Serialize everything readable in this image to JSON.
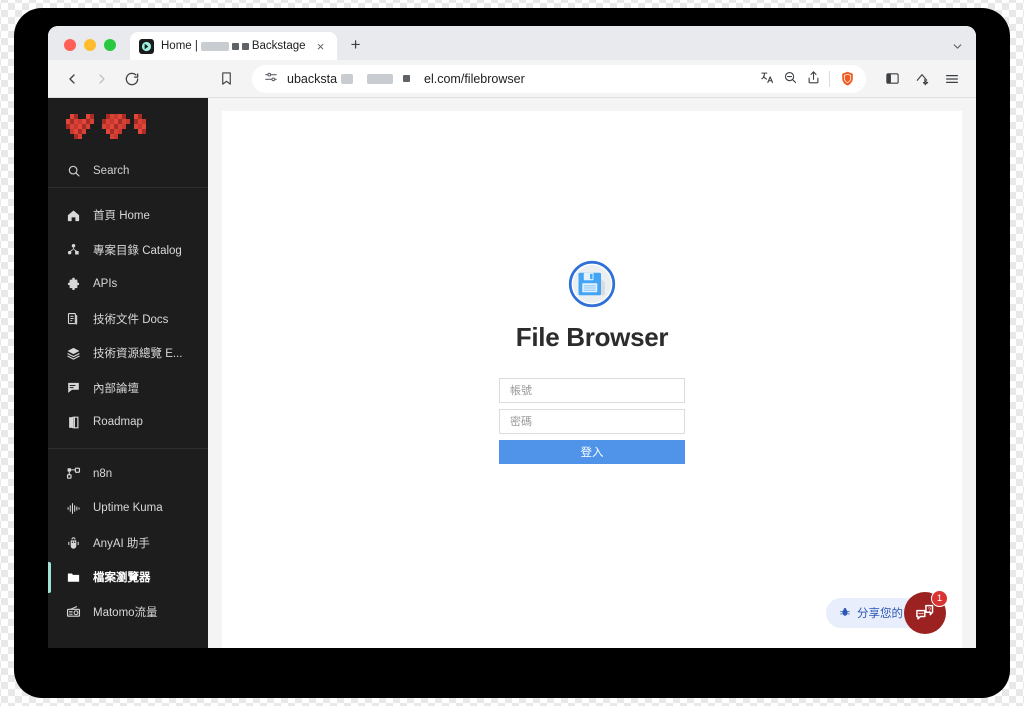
{
  "window": {
    "traffic_lights": [
      "close",
      "minimize",
      "maximize"
    ],
    "tab": {
      "title_prefix": "Home |",
      "title_suffix": "Backstage",
      "favicon": "backstage-favicon",
      "close_label": "×"
    },
    "new_tab_label": "+",
    "tabstrip_chevron": "chevron-down-icon"
  },
  "toolbar": {
    "back": "back-arrow-icon",
    "forward": "forward-arrow-icon",
    "reload": "reload-icon",
    "bookmark": "bookmark-icon",
    "omnibox": {
      "permissions_icon": "site-settings-icon",
      "url_prefix": "ubacksta",
      "url_suffix": "el.com/filebrowser"
    },
    "translate": "translate-icon",
    "zoom_out": "zoom-out-icon",
    "share": "share-icon",
    "shields": "brave-shields-icon",
    "side_panel": "side-panel-icon",
    "leo_ai": "leo-sparkle-icon",
    "menu": "hamburger-menu-icon"
  },
  "sidebar": {
    "logo": "redacted-logo",
    "search": {
      "label": "Search",
      "icon": "search-icon"
    },
    "groups": [
      {
        "items": [
          {
            "label": "首頁 Home",
            "icon": "home-icon",
            "active": false
          },
          {
            "label": "專案目錄 Catalog",
            "icon": "catalog-icon",
            "active": false
          },
          {
            "label": "APIs",
            "icon": "puzzle-icon",
            "active": false
          },
          {
            "label": "技術文件 Docs",
            "icon": "docs-icon",
            "active": false
          },
          {
            "label": "技術資源總覽 E...",
            "icon": "layers-icon",
            "active": false
          },
          {
            "label": "內部論壇",
            "icon": "forum-icon",
            "active": false
          },
          {
            "label": "Roadmap",
            "icon": "book-icon",
            "active": false
          }
        ]
      },
      {
        "items": [
          {
            "label": "n8n",
            "icon": "workflow-icon",
            "active": false
          },
          {
            "label": "Uptime Kuma",
            "icon": "pulse-icon",
            "active": false
          },
          {
            "label": "AnyAI 助手",
            "icon": "robot-icon",
            "active": false
          },
          {
            "label": "檔案瀏覽器",
            "icon": "folder-icon",
            "active": true
          },
          {
            "label": "Matomo流量",
            "icon": "radio-icon",
            "active": false
          }
        ]
      }
    ],
    "accent_color": "#9fe2d8",
    "background_color": "#1d1d1d"
  },
  "filebrowser": {
    "logo_icon": "floppy-disk-icon",
    "title": "File Browser",
    "username_placeholder": "帳號",
    "password_placeholder": "密碼",
    "username_value": "",
    "password_value": "",
    "submit_label": "登入",
    "submit_color": "#4f94e8"
  },
  "feedback_widget": {
    "label": "分享您的",
    "icon": "bug-icon",
    "bubble_icon": "chat-question-icon",
    "badge_count": "1",
    "bubble_color": "#9c2222"
  }
}
